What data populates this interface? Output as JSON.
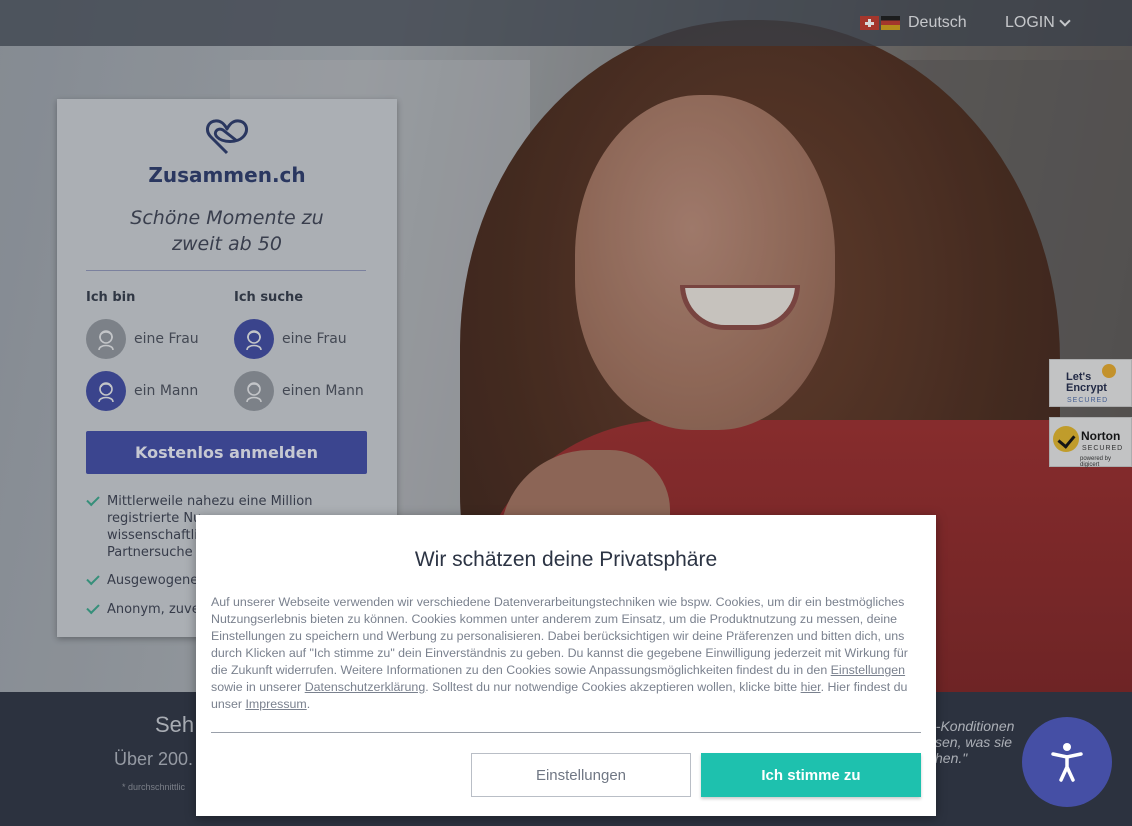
{
  "topbar": {
    "language": "Deutsch",
    "login": "LOGIN",
    "icons": [
      "swiss-flag-icon",
      "german-flag-icon",
      "chevron-down-icon"
    ]
  },
  "card": {
    "brand": "Zusammen.ch",
    "tagline_line1": "Schöne Momente zu",
    "tagline_line2": "zweit ab 50",
    "i_am": {
      "heading": "Ich bin",
      "options": [
        {
          "label": "eine Frau",
          "selected": false
        },
        {
          "label": "ein Mann",
          "selected": true
        }
      ]
    },
    "i_seek": {
      "heading": "Ich suche",
      "options": [
        {
          "label": "eine Frau",
          "selected": true
        },
        {
          "label": "einen Mann",
          "selected": false
        }
      ]
    },
    "cta": "Kostenlos anmelden",
    "bullets": [
      "Mittlerweile nahezu eine Million",
      "registrierte Nu",
      "wissenschaftlic",
      "Partnersuche",
      "Ausgewogenes",
      "Anonym, zuver"
    ],
    "accent_color": "#404ba4",
    "check_color": "#3aa58a"
  },
  "badges": {
    "letsencrypt_line1": "Let's",
    "letsencrypt_line2": "Encrypt",
    "letsencrypt_sub": "SECURED",
    "norton_name": "Norton",
    "norton_sub": "SECURED",
    "norton_powered": "powered by digicert"
  },
  "bottom": {
    "heading": "Seh",
    "subheading": "Über 200.",
    "note": "* durchschnittlic",
    "quote_line1": "n-Konditionen",
    "quote_line2": "ssen, was sie",
    "quote_line3": "chen.\""
  },
  "cookie_modal": {
    "title": "Wir schätzen deine Privatsphäre",
    "text_part1": "Auf unserer Webseite verwenden wir verschiedene Datenverarbeitungstechniken wie bspw. Cookies, um dir ein bestmögliches Nutzungserlebnis bieten zu können. Cookies kommen unter anderem zum Einsatz, um die Produktnutzung zu messen, deine Einstellungen zu speichern und Werbung zu personalisieren. Dabei berücksichtigen wir deine Präferenzen und bitten dich, uns durch Klicken auf \"Ich stimme zu\" dein Einverständnis zu geben. Du kannst die gegebene Einwilligung jederzeit mit Wirkung für die Zukunft widerrufen. Weitere Informationen zu den Cookies sowie Anpassungsmöglichkeiten findest du in den",
    "link_settings": "Einstellungen",
    "text_part2": "sowie in unserer",
    "link_privacy": "Datenschutzerklärung",
    "text_part3": ". Solltest du nur notwendige Cookies akzeptieren wollen, klicke bitte",
    "link_here": "hier",
    "text_part4": ". Hier findest du unser",
    "link_imprint": "Impressum",
    "text_part5": ".",
    "btn_settings": "Einstellungen",
    "btn_accept": "Ich stimme zu",
    "accept_color": "#1ec1ae"
  },
  "accessibility": {
    "icon": "accessibility-icon"
  }
}
